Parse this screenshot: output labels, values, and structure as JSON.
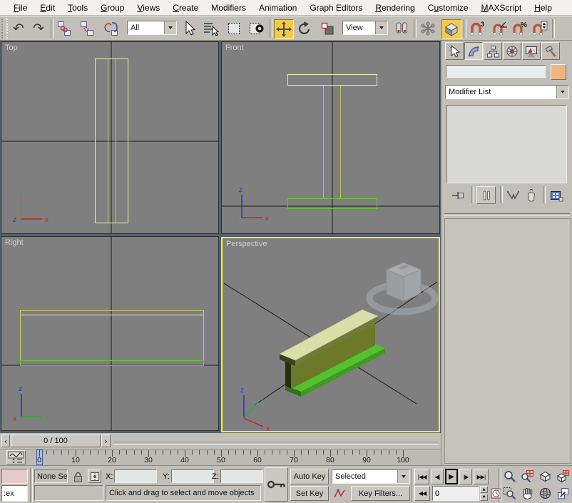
{
  "menu": {
    "items": [
      {
        "label": "File",
        "u": 0
      },
      {
        "label": "Edit",
        "u": 0
      },
      {
        "label": "Tools",
        "u": 0
      },
      {
        "label": "Group",
        "u": 0
      },
      {
        "label": "Views",
        "u": 0
      },
      {
        "label": "Create",
        "u": 0
      },
      {
        "label": "Modifiers",
        "u": -1
      },
      {
        "label": "Animation",
        "u": -1
      },
      {
        "label": "Graph Editors",
        "u": -1
      },
      {
        "label": "Rendering",
        "u": 0
      },
      {
        "label": "Customize",
        "u": 1
      },
      {
        "label": "MAXScript",
        "u": 0
      },
      {
        "label": "Help",
        "u": 0
      }
    ]
  },
  "toolbar": {
    "selection_filter": "All",
    "coordinate_system": "View"
  },
  "viewports": {
    "top_label": "Top",
    "front_label": "Front",
    "right_label": "Right",
    "perspective_label": "Perspective"
  },
  "timeline": {
    "slider_value": "0 / 100",
    "frame_start": 0,
    "frame_end": 100,
    "current_frame": 0,
    "minor_tick_step": 2,
    "tick_labels": [
      0,
      10,
      20,
      30,
      40,
      50,
      60,
      70,
      80,
      90,
      100
    ]
  },
  "status_bar": {
    "mini_listener_text": ":ex",
    "selection_status": "None Se",
    "x_label": "X:",
    "y_label": "Y:",
    "z_label": "Z:",
    "x_value": "",
    "y_value": "",
    "z_value": "",
    "prompt": "Click and drag to select and move objects",
    "auto_key_label": "Auto Key",
    "set_key_label": "Set Key",
    "key_filter_selection": "Selected",
    "key_filters_label": "Key Filters...",
    "frame_value": "0"
  },
  "command_panel": {
    "object_name_value": "",
    "modifier_list_label": "Modifier List",
    "object_color": "#f0b57f"
  },
  "icons": {
    "undo-icon": "↶",
    "redo-icon": "↷",
    "slider-prev-icon": "‹",
    "slider-next-icon": "›",
    "go-start-icon": "|◀◀",
    "prev-frame-icon": "◀|",
    "play-icon": "▶",
    "next-frame-icon": "|▶",
    "go-end-icon": "▶▶|",
    "key-mode-icon": "◀◀",
    "spinner-up-icon": "▲",
    "spinner-down-icon": "▼"
  },
  "colors": {
    "active_viewport_border": "#ffff00",
    "toggle_active": "#f2cb4a",
    "viewport_bg": "#7f7f7f",
    "ui_bg": "#c2bfb8",
    "wire_pale": "#e9ecb4",
    "wire_olive": "#b9c24b",
    "wire_green": "#66cc33",
    "beam_top_face": "#d9dfa8",
    "beam_web_face": "#6b7929",
    "beam_bottom_flange": "#54c12e",
    "axis_x": "#cc2222",
    "axis_y": "#2faf2f",
    "axis_z": "#2233cc",
    "macro_recorder_bg": "#e7c9c9"
  }
}
